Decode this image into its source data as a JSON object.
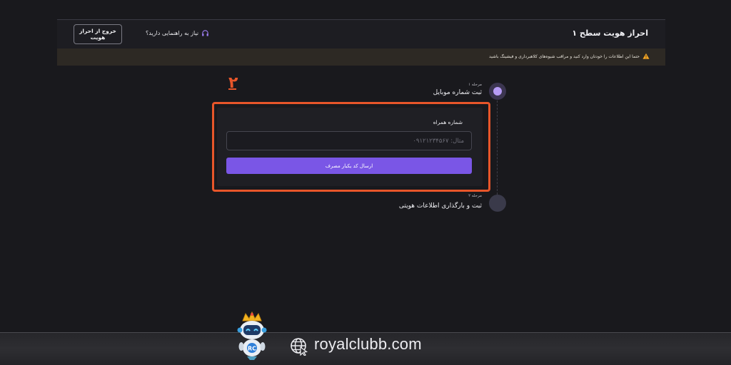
{
  "header": {
    "title": "احراز هویت سطح ۱",
    "help_text": "نیاز به راهنمایی دارید؟",
    "help_icon": "headset-icon",
    "exit_label": "خروج از احراز هویت"
  },
  "warning": {
    "icon": "warning-triangle-icon",
    "text": "حتما این اطلاعات را خودتان وارد کنید و مراقب شیوه‌های کلاهبرداری و فیشینگ باشید",
    "color": "#f5a623"
  },
  "annotation": {
    "marker": "۲",
    "color": "#e8562a"
  },
  "steps": [
    {
      "sub": "مرحله ۱",
      "title": "ثبت شماره موبایل",
      "active": true
    },
    {
      "sub": "مرحله ۲",
      "title": "ثبت و بارگذاری اطلاعات هویتی",
      "active": false
    }
  ],
  "form": {
    "phone_label": "شماره همراه",
    "phone_placeholder": "مثال: ۰۹۱۲۱۲۳۴۵۶۷",
    "phone_value": "",
    "submit_label": "ارسال کد یکبار مصرف",
    "accent": "#7a56e6"
  },
  "footer": {
    "mascot": "robot-mascot-with-crown",
    "globe_icon": "globe-icon",
    "url": "royalclubb.com"
  }
}
